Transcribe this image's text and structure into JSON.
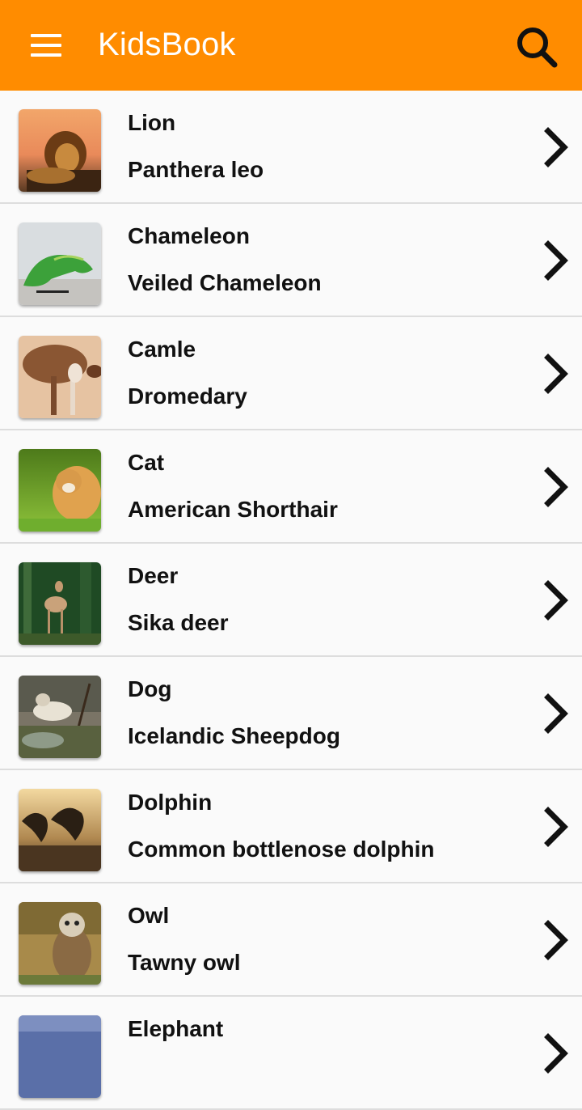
{
  "app_bar": {
    "title": "KidsBook",
    "menu_icon": "hamburger-menu-icon",
    "search_icon": "search-icon",
    "color": "#ff8c00"
  },
  "animals": [
    {
      "name": "Lion",
      "species": "Panthera leo"
    },
    {
      "name": "Chameleon",
      "species": "Veiled Chameleon"
    },
    {
      "name": "Camle",
      "species": "Dromedary"
    },
    {
      "name": "Cat",
      "species": "American Shorthair"
    },
    {
      "name": "Deer",
      "species": "Sika deer"
    },
    {
      "name": "Dog",
      "species": "Icelandic Sheepdog"
    },
    {
      "name": "Dolphin",
      "species": "Common bottlenose dolphin"
    },
    {
      "name": "Owl",
      "species": "Tawny owl"
    },
    {
      "name": "Elephant",
      "species": ""
    }
  ]
}
